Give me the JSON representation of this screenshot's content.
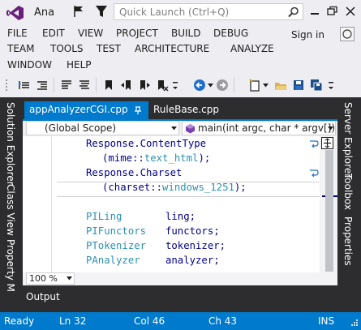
{
  "window": {
    "title": "Ana",
    "quick_launch_placeholder": "Quick Launch (Ctrl+Q)",
    "sign_in": "Sign in"
  },
  "menu_row1": [
    "FILE",
    "EDIT",
    "VIEW",
    "PROJECT",
    "BUILD",
    "DEBUG"
  ],
  "menu_row2": [
    "TEAM",
    "TOOLS",
    "TEST",
    "ARCHITECTURE",
    "ANALYZE"
  ],
  "menu_row3": [
    "WINDOW",
    "HELP"
  ],
  "left_panels": [
    "Solution Explorer",
    "Class View",
    "Property M"
  ],
  "right_panels": [
    "Server Explorer",
    "Toolbox",
    "Properties"
  ],
  "tabs": {
    "active": "appAnalyzerCGI.cpp",
    "inactive": "RuleBase.cpp"
  },
  "nav": {
    "scope": "(Global Scope)",
    "member": "main(int argc, char * argv[])"
  },
  "code": {
    "l1": "Response.ContentType",
    "l2a": "(mime::",
    "l2b": "text_html",
    "l2c": ");",
    "l3": "Response.Charset",
    "l4a": "(charset::",
    "l4b": "windows_1251",
    "l4c": ");",
    "d1t": "PILing",
    "d1v": "ling;",
    "d2t": "PIFunctors",
    "d2v": "functors;",
    "d3t": "PTokenizer",
    "d3v": "tokenizer;",
    "d4t": "PAnalyzer",
    "d4v": "analyzer;"
  },
  "zoom": "100 %",
  "output_tab": "Output",
  "status": {
    "ready": "Ready",
    "ln": "Ln 32",
    "col": "Col 46",
    "ch": "Ch 43",
    "ins": "INS"
  },
  "colors": {
    "accent": "#007acc",
    "dark_panel": "#2d2d30",
    "logo": "#68217a"
  }
}
